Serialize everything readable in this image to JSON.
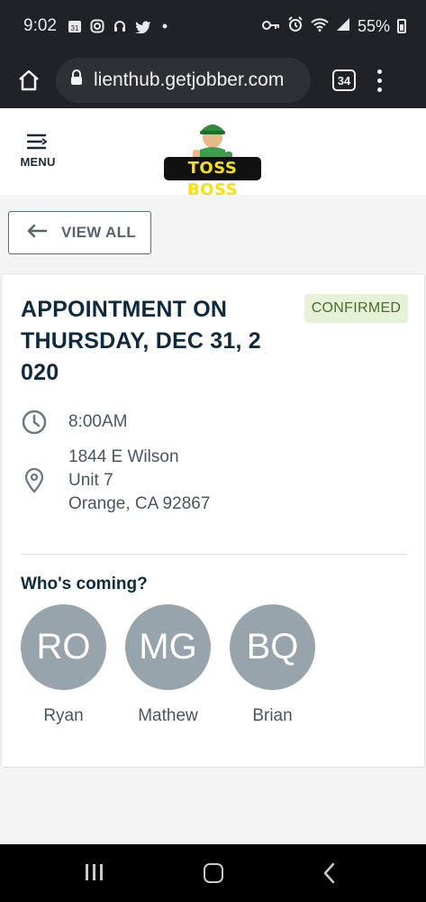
{
  "status_bar": {
    "time": "9:02",
    "battery": "55%",
    "icons": [
      "calendar-icon",
      "instagram-icon",
      "headset-icon",
      "twitter-icon",
      "dot-icon",
      "key-icon",
      "alarm-icon",
      "wifi-icon",
      "signal-icon",
      "battery-icon"
    ]
  },
  "browser": {
    "url": "lienthub.getjobber.com",
    "tab_count": "34"
  },
  "header": {
    "menu_label": "MENU",
    "logo_text": "TOSS BOSS"
  },
  "nav": {
    "view_all_label": "VIEW ALL"
  },
  "appointment": {
    "title": "APPOINTMENT ON THURSDAY, DEC 31, 2 020",
    "status": "CONFIRMED",
    "time": "8:00AM",
    "address": {
      "line1": "1844 E Wilson",
      "line2": "Unit 7",
      "line3": "Orange, CA 92867"
    },
    "attendees_heading": "Who's coming?",
    "attendees": [
      {
        "initials": "RO",
        "name": "Ryan"
      },
      {
        "initials": "MG",
        "name": "Mathew"
      },
      {
        "initials": "BQ",
        "name": "Brian"
      }
    ]
  },
  "colors": {
    "brand_dark": "#0e2a3c",
    "badge_bg": "#e6f1d8",
    "badge_text": "#4b6b2a",
    "avatar_bg": "#98a4ab"
  }
}
